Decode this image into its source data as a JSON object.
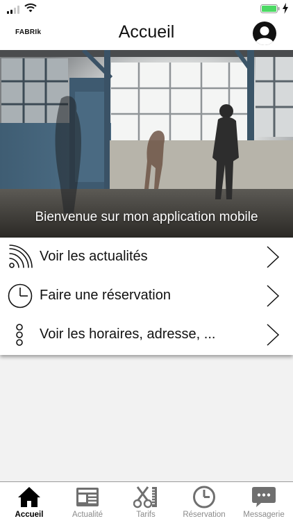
{
  "header": {
    "brand": "FABRIk",
    "title": "Accueil"
  },
  "hero": {
    "caption": "Bienvenue sur mon application mobile"
  },
  "menu": {
    "items": [
      {
        "label": "Voir les actualités",
        "icon": "rss-icon"
      },
      {
        "label": "Faire une réservation",
        "icon": "clock-icon"
      },
      {
        "label": "Voir les horaires, adresse, ...",
        "icon": "more-vertical-icon"
      }
    ]
  },
  "tabs": [
    {
      "label": "Accueil",
      "icon": "home-icon",
      "active": true
    },
    {
      "label": "Actualité",
      "icon": "newspaper-icon",
      "active": false
    },
    {
      "label": "Tarifs",
      "icon": "scissors-icon",
      "active": false
    },
    {
      "label": "Réservation",
      "icon": "clock-icon",
      "active": false
    },
    {
      "label": "Messagerie",
      "icon": "chat-icon",
      "active": false
    }
  ],
  "colors": {
    "active_tab": "#000000",
    "inactive_tab": "#8a8a8a",
    "battery": "#4cd964"
  }
}
